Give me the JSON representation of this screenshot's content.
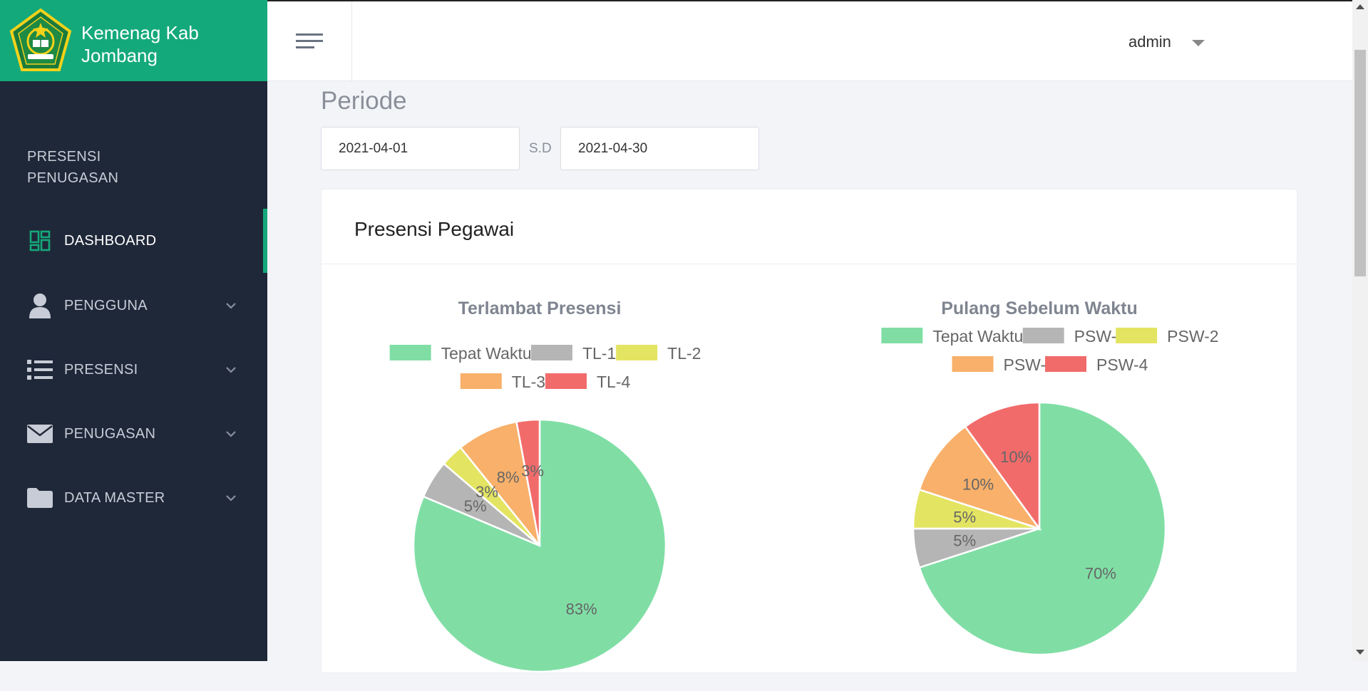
{
  "brand": {
    "title": "Kemenag Kab Jombang"
  },
  "sidebar": {
    "section_label": "PRESENSI PENUGASAN",
    "items": [
      {
        "label": "DASHBOARD",
        "icon": "dashboard-icon",
        "active": true
      },
      {
        "label": "PENGGUNA",
        "icon": "user-icon"
      },
      {
        "label": "PRESENSI",
        "icon": "list-icon"
      },
      {
        "label": "PENUGASAN",
        "icon": "envelope-icon"
      },
      {
        "label": "DATA MASTER",
        "icon": "folder-icon"
      }
    ]
  },
  "header": {
    "user": "admin"
  },
  "periode": {
    "title": "Periode",
    "start": "2021-04-01",
    "separator": "S.D",
    "end": "2021-04-30"
  },
  "card": {
    "title": "Presensi Pegawai"
  },
  "colors": {
    "green": "#80dea5",
    "gray": "#b5b5b5",
    "yellow": "#e3e462",
    "orange": "#f8b06a",
    "red": "#f26b6b",
    "brand": "#14a97a",
    "sidebar": "#1f2839"
  },
  "chart_data": [
    {
      "type": "pie",
      "title": "Terlambat Presensi",
      "legend_placement": "top",
      "labels": [
        "Tepat Waktu",
        "TL-1",
        "TL-2",
        "TL-3",
        "TL-4"
      ],
      "values": [
        83,
        5,
        3,
        8,
        3
      ],
      "value_labels": [
        "83%",
        "5%",
        "3%",
        "8%",
        "3%"
      ],
      "colors": [
        "#80dea5",
        "#b5b5b5",
        "#e3e462",
        "#f8b06a",
        "#f26b6b"
      ]
    },
    {
      "type": "pie",
      "title": "Pulang Sebelum Waktu",
      "legend_placement": "top",
      "labels": [
        "Tepat Waktu",
        "PSW-1",
        "PSW-2",
        "PSW-3",
        "PSW-4"
      ],
      "values": [
        70,
        5,
        5,
        10,
        10
      ],
      "value_labels": [
        "70%",
        "5%",
        "5%",
        "10%",
        "10%"
      ],
      "colors": [
        "#80dea5",
        "#b5b5b5",
        "#e3e462",
        "#f8b06a",
        "#f26b6b"
      ]
    }
  ]
}
